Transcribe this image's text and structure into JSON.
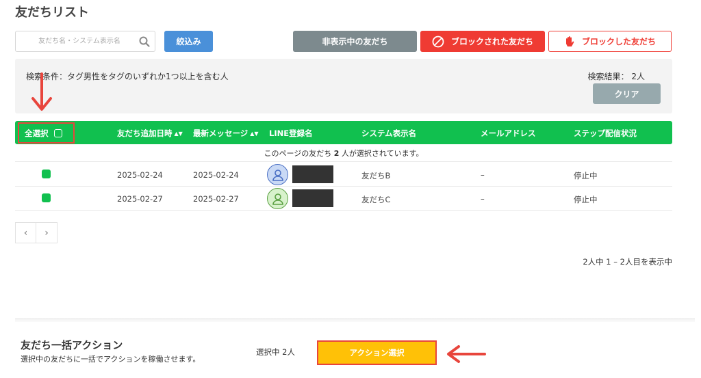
{
  "page": {
    "title": "友だちリスト"
  },
  "search": {
    "placeholder": "友だち名・システム表示名",
    "value": "",
    "icon": "search-icon"
  },
  "toolbar": {
    "filter_label": "絞込み",
    "hidden_friends_label": "非表示中の友だち",
    "blocked_friends_label": "ブロックされた友だち",
    "blocked_by_me_label": "ブロックした友だち"
  },
  "condition": {
    "text": "検索条件：タグ男性をタグのいずれか1つ以上を含む人",
    "result": "検索結果： 2人",
    "clear_label": "クリア"
  },
  "table": {
    "headers": {
      "select_all": "全選択",
      "added_at": "友だち追加日時",
      "latest_message": "最新メッセージ",
      "line_name": "LINE登録名",
      "system_name": "システム表示名",
      "email": "メールアドレス",
      "step_status": "ステップ配信状況"
    },
    "selected_note_pre": "このページの友だち",
    "selected_note_count": "2",
    "selected_note_post": "人が選択されています。",
    "rows": [
      {
        "added_at": "2025-02-24",
        "latest_message": "2025-02-24",
        "system_name": "友だちB",
        "email": "–",
        "step_status": "停止中",
        "avatar_color": "#c9d9f5",
        "avatar_stroke": "#4a6fc4"
      },
      {
        "added_at": "2025-02-27",
        "latest_message": "2025-02-27",
        "system_name": "友だちC",
        "email": "–",
        "step_status": "停止中",
        "avatar_color": "#d8f2cc",
        "avatar_stroke": "#5aa043"
      }
    ]
  },
  "pagination": {
    "prev": "‹",
    "next": "›",
    "range_text": "2人中 1 – 2人目を表示中"
  },
  "bulk": {
    "title": "友だち一括アクション",
    "description": "選択中の友だちに一括でアクションを稼働させます。",
    "selected_count": "選択中 2人",
    "action_label": "アクション選択"
  },
  "colors": {
    "accent_green": "#11c04f",
    "block_red": "#ef3b33",
    "action_yellow": "#ffc107",
    "filter_blue": "#4a90d9",
    "annotation_red": "#e8453c"
  }
}
